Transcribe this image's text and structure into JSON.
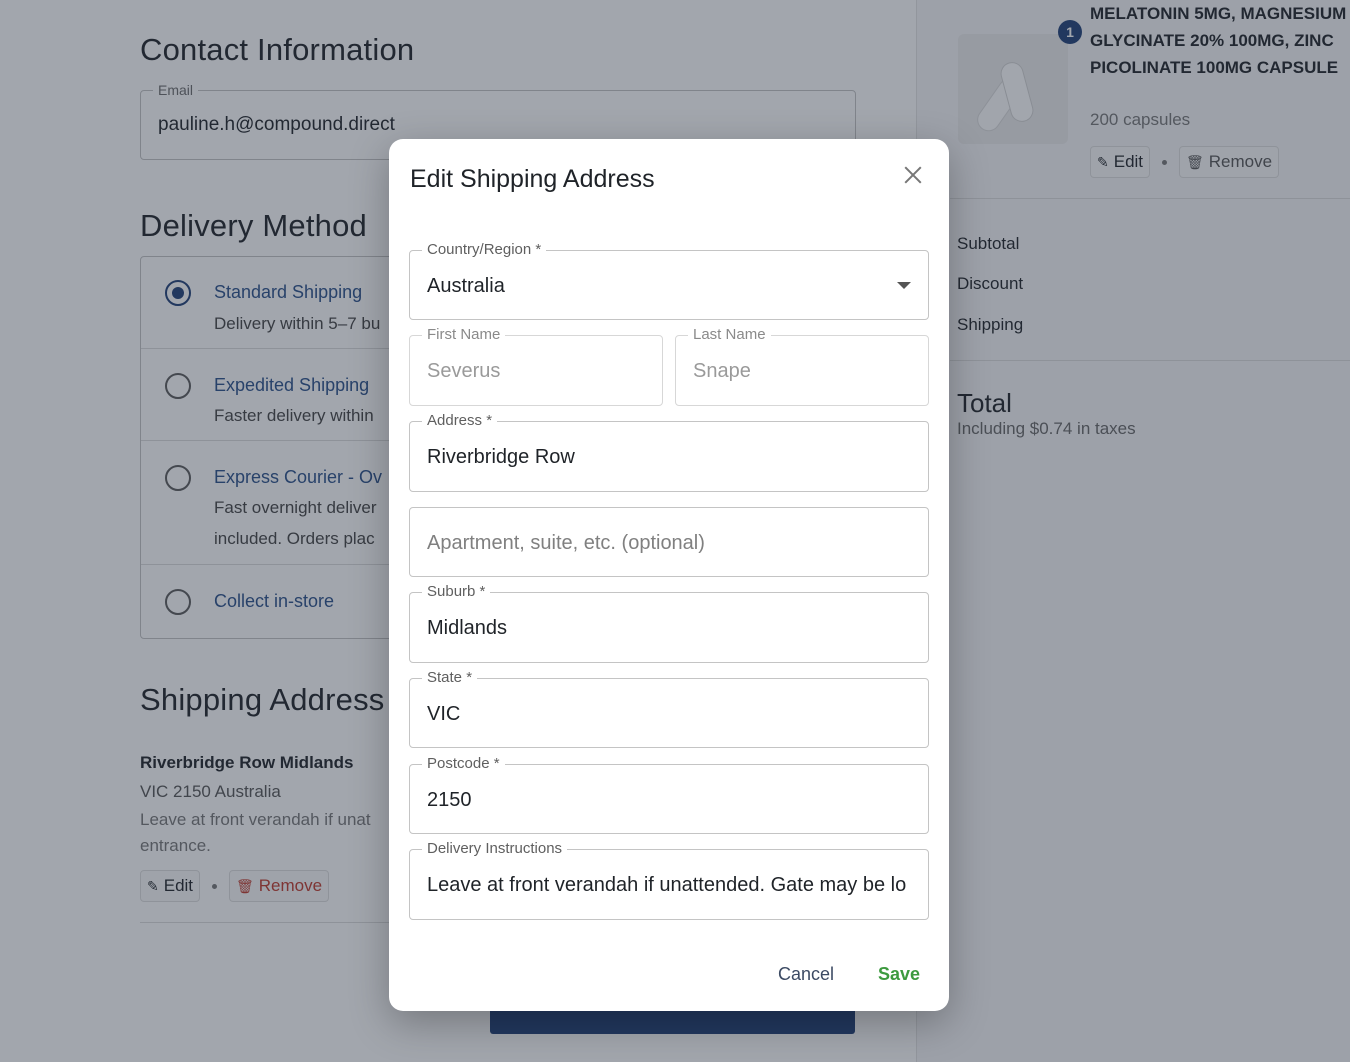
{
  "contact": {
    "title": "Contact Information",
    "email_label": "Email",
    "email_value": "pauline.h@compound.direct"
  },
  "delivery": {
    "title": "Delivery Method",
    "options": [
      {
        "title": "Standard Shipping",
        "desc1": "Delivery within 5–7 bu",
        "desc2": ""
      },
      {
        "title": "Expedited Shipping",
        "desc1": "Faster delivery within",
        "desc2": ""
      },
      {
        "title": "Express Courier - Ov",
        "desc1": "Fast overnight deliver",
        "desc2": "included. Orders plac"
      },
      {
        "title": "Collect in-store",
        "desc1": "",
        "desc2": ""
      }
    ],
    "selected_index": 0
  },
  "shipping": {
    "title": "Shipping Address",
    "line1": "Riverbridge Row Midlands",
    "line2": "VIC 2150 Australia",
    "note1": "Leave at front verandah if unat",
    "note2": "entrance.",
    "edit_label": "Edit",
    "remove_label": "Remove"
  },
  "summary": {
    "badge_count": "1",
    "product_name": "MELATONIN 5MG, MAGNESIUM GLYCINATE 20% 100MG, ZINC PICOLINATE 100MG CAPSULE",
    "product_qty": "200 capsules",
    "edit_label": "Edit",
    "remove_label": "Remove",
    "subtotal_label": "Subtotal",
    "discount_label": "Discount",
    "shipping_label": "Shipping",
    "total_label": "Total",
    "tax_note": "Including $0.74 in taxes"
  },
  "modal": {
    "title": "Edit Shipping Address",
    "country_label": "Country/Region *",
    "country_value": "Australia",
    "first_name_label": "First Name",
    "first_name_value": "Severus",
    "last_name_label": "Last Name",
    "last_name_value": "Snape",
    "address_label": "Address *",
    "address_value": "Riverbridge Row",
    "apartment_placeholder": "Apartment, suite, etc. (optional)",
    "suburb_label": "Suburb *",
    "suburb_value": "Midlands",
    "state_label": "State *",
    "state_value": "VIC",
    "postcode_label": "Postcode *",
    "postcode_value": "2150",
    "instructions_label": "Delivery Instructions",
    "instructions_value": "Leave at front verandah if unattended. Gate may be lo",
    "cancel_label": "Cancel",
    "save_label": "Save"
  }
}
